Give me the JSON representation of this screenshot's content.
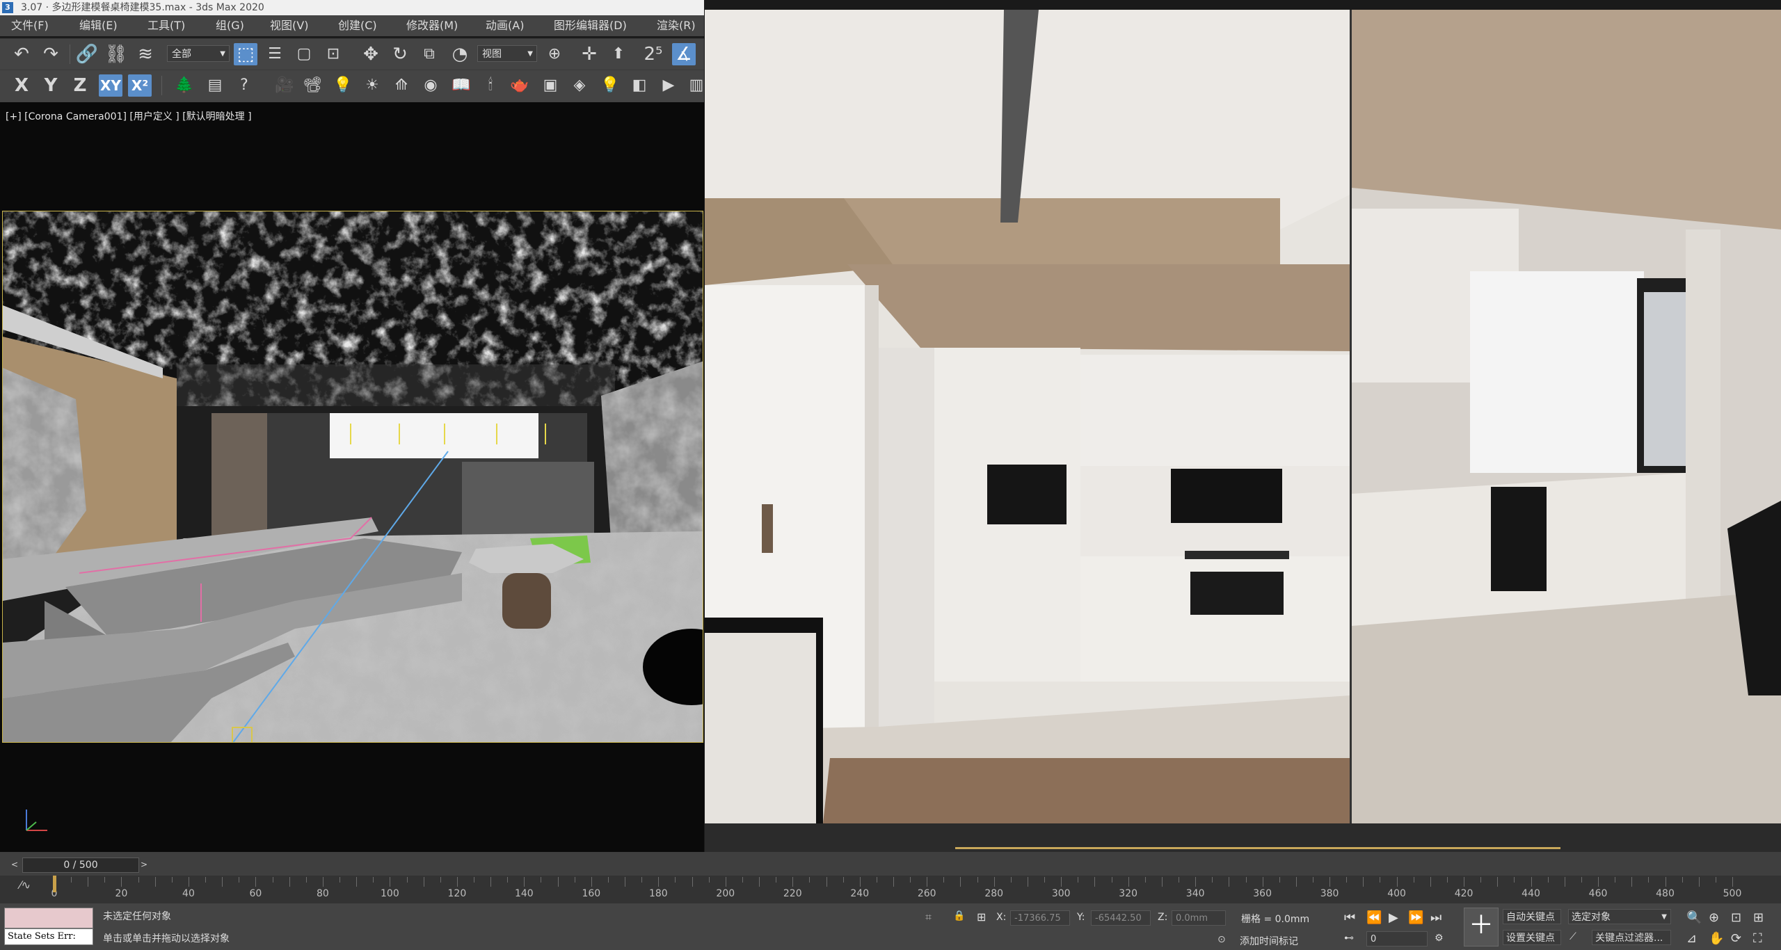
{
  "window": {
    "title": "3.07 · 多边形建模餐桌椅建模35.max - 3ds Max 2020"
  },
  "menu": {
    "items": [
      "文件(F)",
      "编辑(E)",
      "工具(T)",
      "组(G)",
      "视图(V)",
      "创建(C)",
      "修改器(M)",
      "动画(A)",
      "图形编辑器(D)",
      "渲染(R)"
    ]
  },
  "toolbar1": {
    "selection_filter": "全部",
    "ref_coord": "视图"
  },
  "toolbar2": {
    "axis_x": "X",
    "axis_y": "Y",
    "axis_z": "Z",
    "axis_xy": "XY",
    "axis_xy2": "X²"
  },
  "viewport": {
    "label": "[+] [Corona Camera001] [用户定义 ] [默认明暗处理 ]"
  },
  "timeline": {
    "frame_display": "0 / 500",
    "prev_arrow": "<",
    "next_arrow": ">",
    "ticks": [
      0,
      20,
      40,
      60,
      80,
      100,
      120,
      140,
      160,
      180,
      200,
      220,
      240,
      260,
      280,
      300,
      320,
      340,
      360,
      380,
      400,
      420,
      440,
      460,
      480,
      500
    ]
  },
  "status": {
    "maxscript_label": "State Sets Err:",
    "selection_text": "未选定任何对象",
    "prompt_text": "单击或单击并拖动以选择对象",
    "x_label": "X:",
    "x_value": "-17366.75",
    "y_label": "Y:",
    "y_value": "-65442.50",
    "z_label": "Z:",
    "z_value": "0.0mm",
    "grid_text": "栅格 = 0.0mm",
    "add_time_tag": "添加时间标记",
    "auto_key": "自动关键点",
    "set_key": "设置关键点",
    "selected_objects": "选定对象",
    "key_filters": "关键点过滤器...",
    "current_frame": "0"
  },
  "colors": {
    "accent_blue": "#5b8fcb",
    "frame_yellow": "#c9b44a",
    "ui_gray": "#444444"
  }
}
